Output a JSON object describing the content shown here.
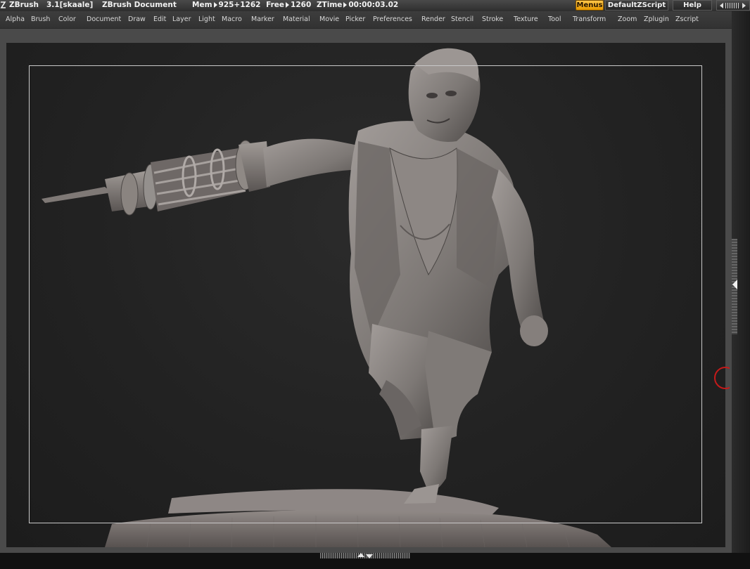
{
  "titlebar": {
    "app_name": "ZBrush",
    "version": "3.1[skaale]",
    "document": "ZBrush Document",
    "mem_label": "Mem",
    "mem_value": "925+1262",
    "free_label": "Free",
    "free_value": "1260",
    "ztime_label": "ZTime",
    "ztime_value": "00:00:03.02",
    "menus_button": "Menus",
    "script_button": "DefaultZScript",
    "help_button": "Help",
    "accent_color": "#f5a800"
  },
  "menubar": {
    "items": [
      {
        "label": "Alpha"
      },
      {
        "label": "Brush"
      },
      {
        "label": "Color"
      },
      {
        "label": "Document"
      },
      {
        "label": "Draw"
      },
      {
        "label": "Edit"
      },
      {
        "label": "Layer"
      },
      {
        "label": "Light"
      },
      {
        "label": "Macro"
      },
      {
        "label": "Marker"
      },
      {
        "label": "Material"
      },
      {
        "label": "Movie"
      },
      {
        "label": "Picker"
      },
      {
        "label": "Preferences"
      },
      {
        "label": "Render"
      },
      {
        "label": "Stencil"
      },
      {
        "label": "Stroke"
      },
      {
        "label": "Texture"
      },
      {
        "label": "Tool"
      },
      {
        "label": "Transform"
      },
      {
        "label": "Zoom"
      },
      {
        "label": "Zplugin"
      },
      {
        "label": "Zscript"
      }
    ]
  },
  "canvas": {
    "background_color": "#222222",
    "model_color": "#8c8683",
    "model": "sculpted figure with arm cannon on round base"
  },
  "icons": {
    "logo": "zbrush-logo-icon",
    "tray_toggle": "tray-toggle-icon",
    "side_expand": "side-panel-expand-icon"
  }
}
